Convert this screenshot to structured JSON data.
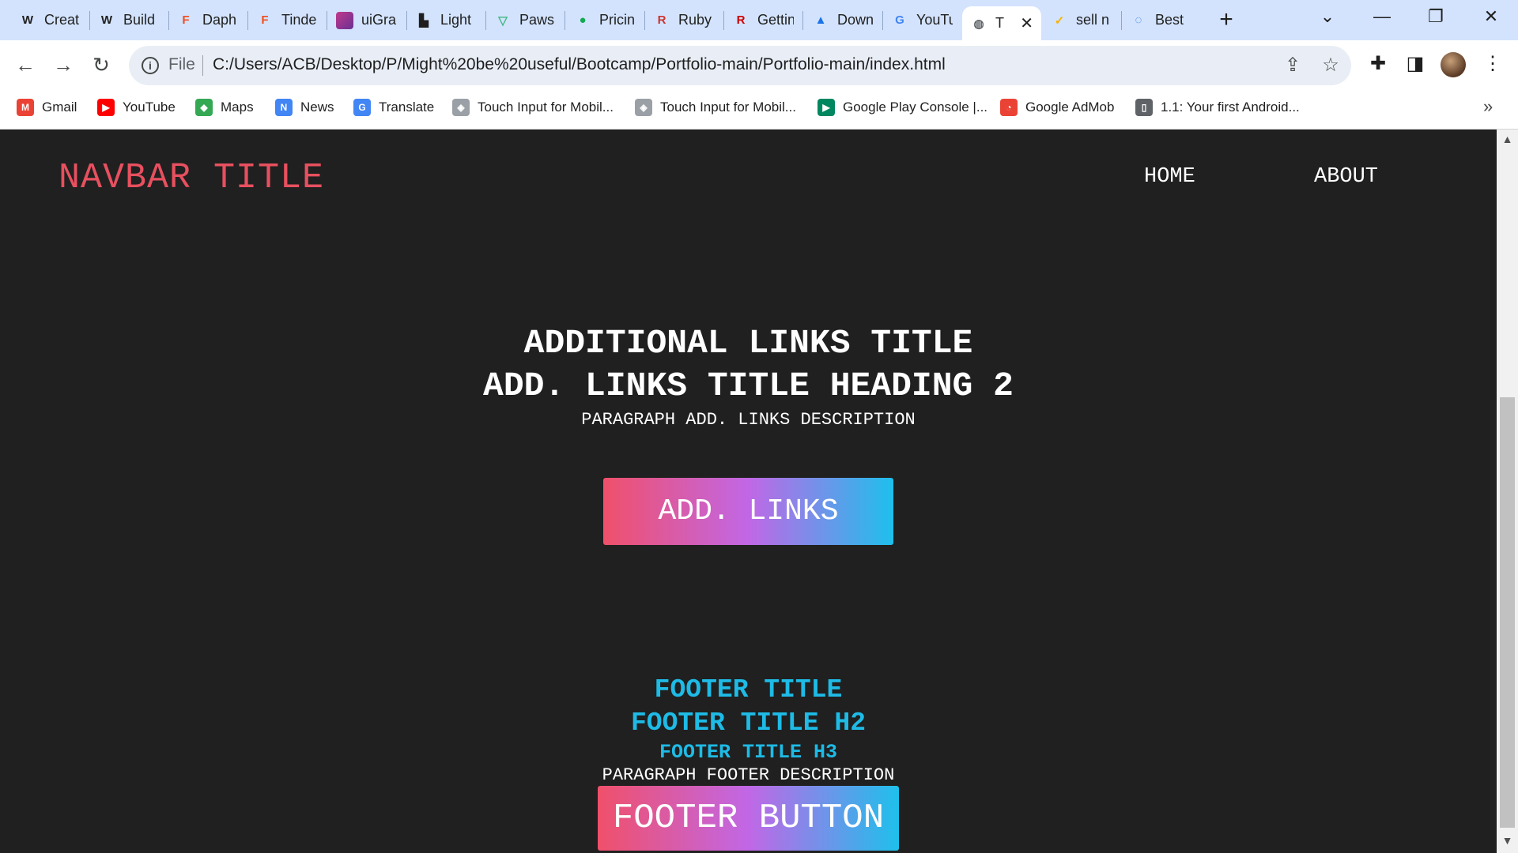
{
  "browser": {
    "tabs": [
      {
        "title": "Creat",
        "icon": "webflow-icon",
        "glyph": "W",
        "color": "#1f1f1f"
      },
      {
        "title": "Build",
        "icon": "webflow-icon",
        "glyph": "W",
        "color": "#1f1f1f"
      },
      {
        "title": "Daph",
        "icon": "figma-icon",
        "glyph": "F",
        "color": "#f24e1e"
      },
      {
        "title": "Tinde",
        "icon": "figma-icon",
        "glyph": "F",
        "color": "#f24e1e"
      },
      {
        "title": "uiGra",
        "icon": "uigradients-icon",
        "glyph": "",
        "color": "#c0398c"
      },
      {
        "title": "Light",
        "icon": "lighthouse-icon",
        "glyph": "▙",
        "color": "#1f1f1f"
      },
      {
        "title": "Paws",
        "icon": "vue-icon",
        "glyph": "▽",
        "color": "#41b883"
      },
      {
        "title": "Pricin",
        "icon": "mongodb-icon",
        "glyph": "●",
        "color": "#13aa52"
      },
      {
        "title": "Ruby",
        "icon": "ruby-icon",
        "glyph": "R",
        "color": "#cc342d"
      },
      {
        "title": "Gettin",
        "icon": "rails-icon",
        "glyph": "R",
        "color": "#cc0000"
      },
      {
        "title": "Down",
        "icon": "drive-icon",
        "glyph": "▲",
        "color": "#1a73e8"
      },
      {
        "title": "YouTu",
        "icon": "google-icon",
        "glyph": "G",
        "color": "#4285f4"
      },
      {
        "title": "T",
        "icon": "globe-icon",
        "glyph": "◍",
        "color": "#5f6368",
        "active": true
      },
      {
        "title": "sell n",
        "icon": "check-icon",
        "glyph": "✓",
        "color": "#f4b400"
      },
      {
        "title": "Best",
        "icon": "loading-icon",
        "glyph": "◌",
        "color": "#1a73e8"
      }
    ],
    "url": "C:/Users/ACB/Desktop/P/Might%20be%20useful/Bootcamp/Portfolio-main/Portfolio-main/index.html",
    "url_scheme_label": "File",
    "bookmarks": [
      {
        "label": "Gmail",
        "icon": "gmail-icon",
        "glyph": "M",
        "color": "#ea4335"
      },
      {
        "label": "YouTube",
        "icon": "youtube-icon",
        "glyph": "▶",
        "color": "#ff0000"
      },
      {
        "label": "Maps",
        "icon": "maps-icon",
        "glyph": "◆",
        "color": "#34a853"
      },
      {
        "label": "News",
        "icon": "news-icon",
        "glyph": "N",
        "color": "#4285f4"
      },
      {
        "label": "Translate",
        "icon": "translate-icon",
        "glyph": "G",
        "color": "#4285f4"
      },
      {
        "label": "Touch Input for Mobil...",
        "icon": "unity-icon",
        "glyph": "◈",
        "color": "#9aa0a6"
      },
      {
        "label": "Touch Input for Mobil...",
        "icon": "unity-icon",
        "glyph": "◈",
        "color": "#9aa0a6"
      },
      {
        "label": "Google Play Console |...",
        "icon": "play-console-icon",
        "glyph": "▶",
        "color": "#01875f"
      },
      {
        "label": "Google AdMob",
        "icon": "admob-icon",
        "glyph": "◔",
        "color": "#ea4335"
      },
      {
        "label": "1.1: Your first Android...",
        "icon": "book-icon",
        "glyph": "▯",
        "color": "#5f6368"
      }
    ]
  },
  "site": {
    "navbar": {
      "title": "NAVBAR TITLE",
      "links": [
        "HOME",
        "ABOUT"
      ]
    },
    "additional_links": {
      "title": "ADDITIONAL LINKS TITLE",
      "heading2": "ADD. LINKS TITLE HEADING 2",
      "description": "PARAGRAPH ADD. LINKS DESCRIPTION",
      "button": "ADD. LINKS"
    },
    "footer": {
      "title": "FOOTER TITLE",
      "title_h2": "FOOTER TITLE H2",
      "title_h3": "FOOTER TITLE H3",
      "description": "PARAGRAPH FOOTER DESCRIPTION",
      "button": "FOOTER BUTTON"
    }
  },
  "colors": {
    "navbar_title": "#e8505f",
    "footer_headings": "#1ebbe6",
    "page_background": "#202020",
    "gradient": [
      "#f0506a",
      "#c167e6",
      "#1ec0ec"
    ]
  }
}
